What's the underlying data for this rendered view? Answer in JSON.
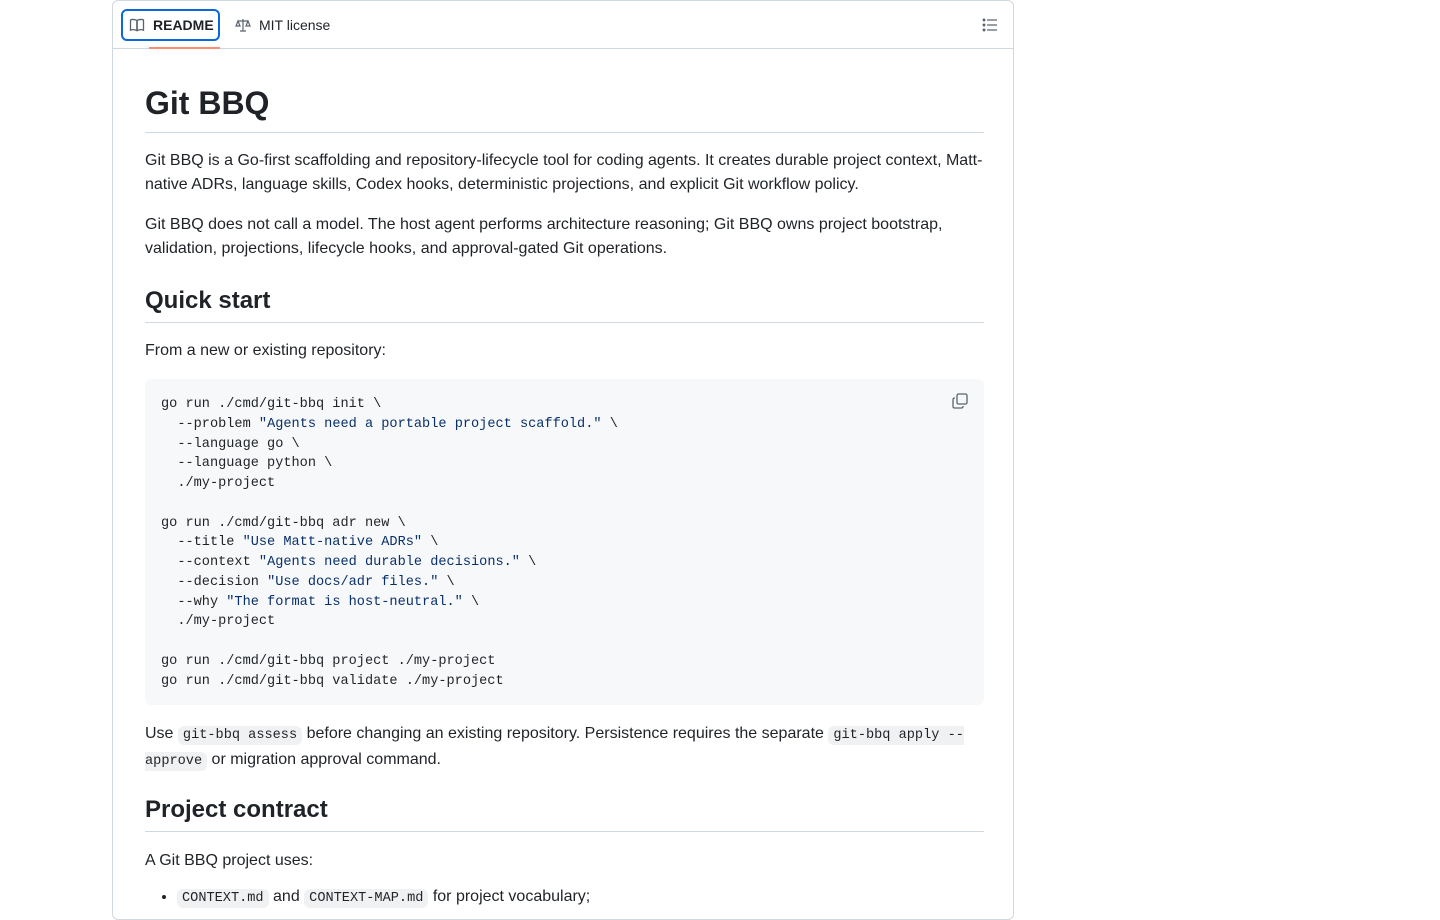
{
  "tabs": {
    "readme_label": "README",
    "license_label": "MIT license"
  },
  "readme": {
    "title": "Git BBQ",
    "intro_p1": "Git BBQ is a Go-first scaffolding and repository-lifecycle tool for coding agents. It creates durable project context, Matt-native ADRs, language skills, Codex hooks, deterministic projections, and explicit Git workflow policy.",
    "intro_p2": "Git BBQ does not call a model. The host agent performs architecture reasoning; Git BBQ owns project bootstrap, validation, projections, lifecycle hooks, and approval-gated Git operations.",
    "quickstart_heading": "Quick start",
    "quickstart_intro": "From a new or existing repository:",
    "code_lines": [
      {
        "text": "go run ./cmd/git-bbq init \\",
        "str": "",
        "tail": ""
      },
      {
        "text": "  --problem ",
        "str": "\"Agents need a portable project scaffold.\"",
        "tail": " \\"
      },
      {
        "text": "  --language go \\",
        "str": "",
        "tail": ""
      },
      {
        "text": "  --language python \\",
        "str": "",
        "tail": ""
      },
      {
        "text": "  ./my-project",
        "str": "",
        "tail": ""
      },
      {
        "text": "",
        "str": "",
        "tail": ""
      },
      {
        "text": "go run ./cmd/git-bbq adr new \\",
        "str": "",
        "tail": ""
      },
      {
        "text": "  --title ",
        "str": "\"Use Matt-native ADRs\"",
        "tail": " \\"
      },
      {
        "text": "  --context ",
        "str": "\"Agents need durable decisions.\"",
        "tail": " \\"
      },
      {
        "text": "  --decision ",
        "str": "\"Use docs/adr files.\"",
        "tail": " \\"
      },
      {
        "text": "  --why ",
        "str": "\"The format is host-neutral.\"",
        "tail": " \\"
      },
      {
        "text": "  ./my-project",
        "str": "",
        "tail": ""
      },
      {
        "text": "",
        "str": "",
        "tail": ""
      },
      {
        "text": "go run ./cmd/git-bbq project ./my-project",
        "str": "",
        "tail": ""
      },
      {
        "text": "go run ./cmd/git-bbq validate ./my-project",
        "str": "",
        "tail": ""
      }
    ],
    "use_p": {
      "t1": "Use ",
      "c1": "git-bbq assess",
      "t2": " before changing an existing repository. Persistence requires the separate ",
      "c2": "git-bbq apply --approve",
      "t3": " or migration approval command."
    },
    "contract_heading": "Project contract",
    "contract_intro": "A Git BBQ project uses:",
    "contract_items": [
      {
        "c1": "CONTEXT.md",
        "t1": " and ",
        "c2": "CONTEXT-MAP.md",
        "t2": " for project vocabulary;"
      }
    ]
  },
  "icons": {
    "readme": "book-icon",
    "license": "law-scale-icon",
    "toc": "list-unordered-icon",
    "copy": "copy-icon"
  },
  "colors": {
    "accent": "#0969da",
    "tab_underline": "#fd8c73",
    "string": "#0a3069"
  }
}
